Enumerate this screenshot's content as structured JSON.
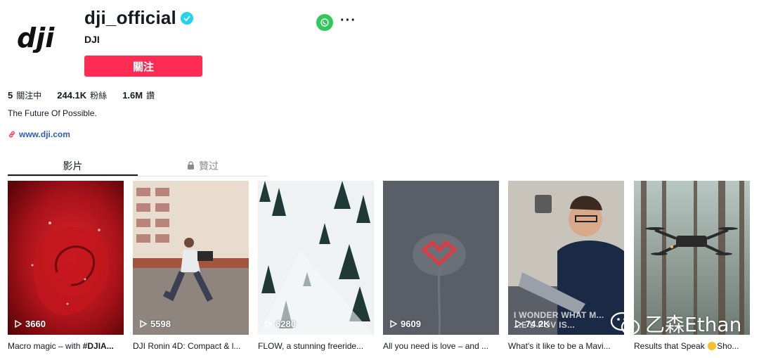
{
  "profile": {
    "username": "dji_official",
    "nickname": "DJI",
    "follow_label": "關注",
    "logo_text": "dji",
    "bio": "The Future Of Possible.",
    "link": "www.dji.com"
  },
  "stats": [
    {
      "value": "5",
      "label": "關注中"
    },
    {
      "value": "244.1K",
      "label": "粉絲"
    },
    {
      "value": "1.6M",
      "label": "讚"
    }
  ],
  "tabs": [
    {
      "label": "影片",
      "active": true
    },
    {
      "label": "贊过",
      "active": false,
      "icon": "lock-icon"
    }
  ],
  "videos": [
    {
      "views": "3660",
      "caption_prefix": "Macro magic – with ",
      "caption_bold": "#DJIA...",
      "caption_suffix": ""
    },
    {
      "views": "5598",
      "caption_prefix": "DJI Ronin 4D: Compact & l...",
      "caption_bold": "",
      "caption_suffix": ""
    },
    {
      "views": "6280",
      "caption_prefix": "FLOW, a stunning freeride...",
      "caption_bold": "",
      "caption_suffix": ""
    },
    {
      "views": "9609",
      "caption_prefix": "All you need is love – and ...",
      "caption_bold": "",
      "caption_suffix": ""
    },
    {
      "views": "74.2K",
      "caption_prefix": "What's it like to be a Mavi...",
      "caption_bold": "",
      "caption_suffix": "",
      "overlay": "I WONDER WHAT M...\n...E'S POV IS..."
    },
    {
      "views": "",
      "caption_prefix": "Results that Speak ",
      "caption_bold": "",
      "caption_suffix": "Sho..."
    }
  ],
  "watermark": "乙森Ethan",
  "colors": {
    "accent": "#fe2c55",
    "verified": "#20d5ec",
    "link": "#2b5db9",
    "whatsapp": "#34c759"
  }
}
